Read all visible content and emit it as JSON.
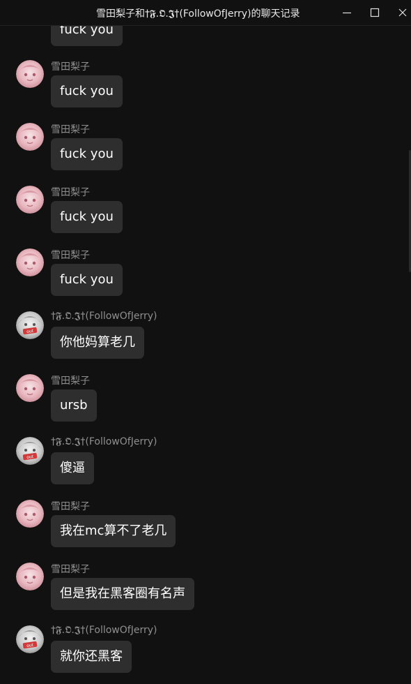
{
  "window": {
    "title": "雪田梨子和†𝕱.𝕺.𝕵†(FollowOfJerry)的聊天记录",
    "buttons": {
      "minimize": "minimize-icon",
      "maximize": "maximize-icon",
      "close": "close-icon"
    }
  },
  "first_bubble": {
    "text": "fuck you"
  },
  "messages": [
    {
      "sender": "雪田梨子",
      "avatar": "pink-anime-avatar",
      "text": "fuck you"
    },
    {
      "sender": "雪田梨子",
      "avatar": "pink-anime-avatar",
      "text": "fuck you"
    },
    {
      "sender": "雪田梨子",
      "avatar": "pink-anime-avatar",
      "text": "fuck you"
    },
    {
      "sender": "雪田梨子",
      "avatar": "pink-anime-avatar",
      "text": "fuck you"
    },
    {
      "sender": "†𝕱.𝕺.𝕵†(FollowOfJerry)",
      "avatar": "grey-anime-avatar",
      "text": "你他妈算老几"
    },
    {
      "sender": "雪田梨子",
      "avatar": "pink-anime-avatar",
      "text": "ursb"
    },
    {
      "sender": "†𝕱.𝕺.𝕵†(FollowOfJerry)",
      "avatar": "grey-anime-avatar",
      "text": "傻逼"
    },
    {
      "sender": "雪田梨子",
      "avatar": "pink-anime-avatar",
      "text": "我在mc算不了老几"
    },
    {
      "sender": "雪田梨子",
      "avatar": "pink-anime-avatar",
      "text": "但是我在黑客圈有名声"
    },
    {
      "sender": "†𝕱.𝕺.𝕵†(FollowOfJerry)",
      "avatar": "grey-anime-avatar",
      "text": "就你还黑客"
    }
  ],
  "colors": {
    "background": "#111111",
    "bubble": "#2e2e2e",
    "sender_text": "#8f8f8f",
    "message_text": "#ffffff"
  }
}
